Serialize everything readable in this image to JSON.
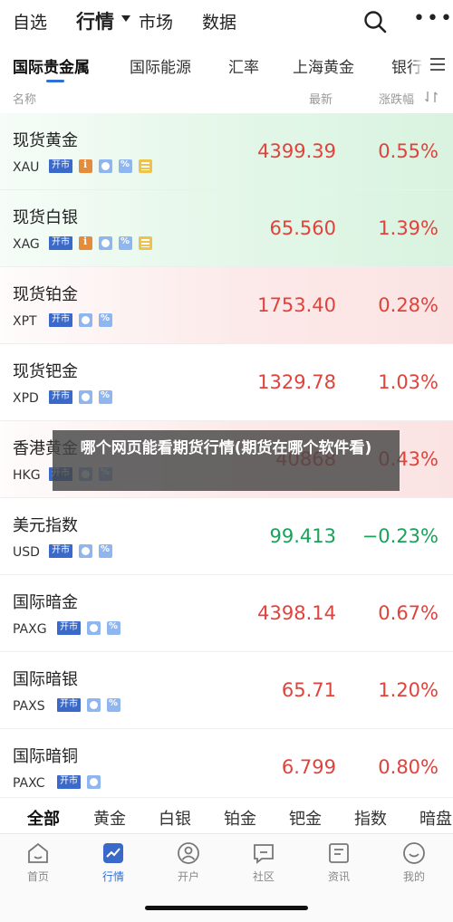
{
  "topnav": {
    "tabs": [
      "自选",
      "行情",
      "市场",
      "数据"
    ],
    "active_tab": "行情",
    "search_icon": "search-icon",
    "more_icon": "more-icon"
  },
  "category_tabs": [
    "国际贵金属",
    "国际能源",
    "汇率",
    "上海黄金",
    "银行"
  ],
  "active_category": "国际贵金属",
  "columns": {
    "name": "名称",
    "latest": "最新",
    "change": "涨跌幅"
  },
  "rows": [
    {
      "name": "现货黄金",
      "code": "XAU",
      "tag": "开市",
      "icons": [
        "info-icon",
        "clock-icon",
        "percent-icon",
        "doc-icon"
      ],
      "price": "4399.39",
      "change": "0.55%",
      "direction": "up",
      "bg": "green"
    },
    {
      "name": "现货白银",
      "code": "XAG",
      "tag": "开市",
      "icons": [
        "info-icon",
        "clock-icon",
        "percent-icon",
        "doc-icon"
      ],
      "price": "65.560",
      "change": "1.39%",
      "direction": "up",
      "bg": "green"
    },
    {
      "name": "现货铂金",
      "code": "XPT",
      "tag": "开市",
      "icons": [
        "clock-icon",
        "percent-icon"
      ],
      "price": "1753.40",
      "change": "0.28%",
      "direction": "up",
      "bg": "red"
    },
    {
      "name": "现货钯金",
      "code": "XPD",
      "tag": "开市",
      "icons": [
        "clock-icon",
        "percent-icon"
      ],
      "price": "1329.78",
      "change": "1.03%",
      "direction": "up",
      "bg": "none"
    },
    {
      "name": "香港黄金",
      "code": "HKG",
      "tag": "开市",
      "icons": [
        "clock-icon",
        "percent-icon"
      ],
      "price": "40868",
      "change": "0.43%",
      "direction": "up",
      "bg": "red"
    },
    {
      "name": "美元指数",
      "code": "USD",
      "tag": "开市",
      "icons": [
        "clock-icon",
        "percent-icon"
      ],
      "price": "99.413",
      "change": "−0.23%",
      "direction": "down",
      "bg": "none"
    },
    {
      "name": "国际暗金",
      "code": "PAXG",
      "tag": "开市",
      "icons": [
        "clock-icon",
        "percent-icon"
      ],
      "price": "4398.14",
      "change": "0.67%",
      "direction": "up",
      "bg": "none"
    },
    {
      "name": "国际暗银",
      "code": "PAXS",
      "tag": "开市",
      "icons": [
        "clock-icon",
        "percent-icon"
      ],
      "price": "65.71",
      "change": "1.20%",
      "direction": "up",
      "bg": "none"
    },
    {
      "name": "国际暗铜",
      "code": "PAXC",
      "tag": "开市",
      "icons": [
        "clock-icon"
      ],
      "price": "6.799",
      "change": "0.80%",
      "direction": "up",
      "bg": "none"
    }
  ],
  "overlay_banner": "哪个网页能看期货行情(期货在哪个软件看)",
  "sub_tabs": [
    "全部",
    "黄金",
    "白银",
    "铂金",
    "钯金",
    "指数",
    "暗盘"
  ],
  "active_sub_tab": "全部",
  "bottom_nav": [
    {
      "label": "首页",
      "icon": "home-icon"
    },
    {
      "label": "行情",
      "icon": "chart-icon"
    },
    {
      "label": "开户",
      "icon": "user-icon"
    },
    {
      "label": "社区",
      "icon": "chat-icon"
    },
    {
      "label": "资讯",
      "icon": "news-icon"
    },
    {
      "label": "我的",
      "icon": "smile-icon"
    }
  ],
  "active_bottom": "行情",
  "colors": {
    "up": "#e0423c",
    "down": "#1aa15a",
    "accent": "#2f6fd6"
  }
}
